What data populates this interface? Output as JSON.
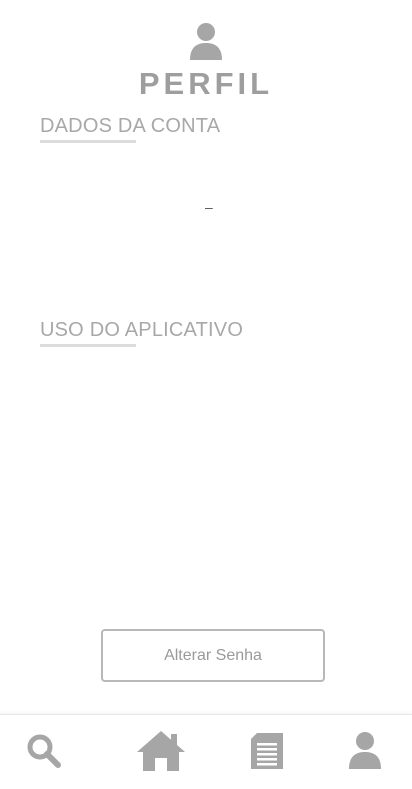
{
  "header": {
    "icon": "user-icon",
    "title": "PERFIL"
  },
  "sections": {
    "account": {
      "title": "DADOS DA CONTA",
      "value": "–"
    },
    "usage": {
      "title": "USO DO APLICATIVO"
    }
  },
  "actions": {
    "change_password_label": "Alterar Senha"
  },
  "tabbar": {
    "items": [
      {
        "icon": "search-icon"
      },
      {
        "icon": "home-icon"
      },
      {
        "icon": "document-icon"
      },
      {
        "icon": "user-icon"
      }
    ]
  },
  "colors": {
    "text_gray": "#9e9e9e",
    "icon_gray": "#a6a6a6",
    "underline": "#dcdcdc"
  }
}
